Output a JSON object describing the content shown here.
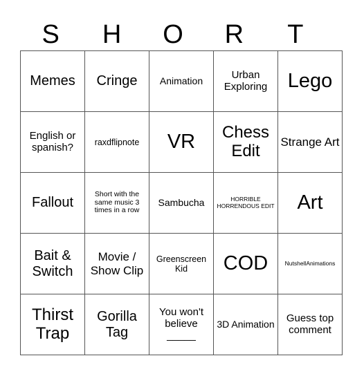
{
  "header": {
    "letters": [
      "S",
      "H",
      "O",
      "R",
      "T"
    ]
  },
  "board": {
    "rows": [
      [
        "Memes",
        "Cringe",
        "Animation",
        "Urban Exploring",
        "Lego"
      ],
      [
        "English or spanish?",
        "raxdflipnote",
        "VR",
        "Chess Edit",
        "Strange Art"
      ],
      [
        "Fallout",
        "Short with the same music 3 times in a row",
        "Sambucha",
        "HORRIBLE HORRENDOUS EDIT",
        "Art"
      ],
      [
        "Bait & Switch",
        "Movie / Show Clip",
        "Greenscreen Kid",
        "COD",
        "NutshellAnimations"
      ],
      [
        "Thirst Trap",
        "Gorilla Tag",
        "You won't believe _____",
        "3D Animation",
        "Guess top comment"
      ]
    ]
  }
}
